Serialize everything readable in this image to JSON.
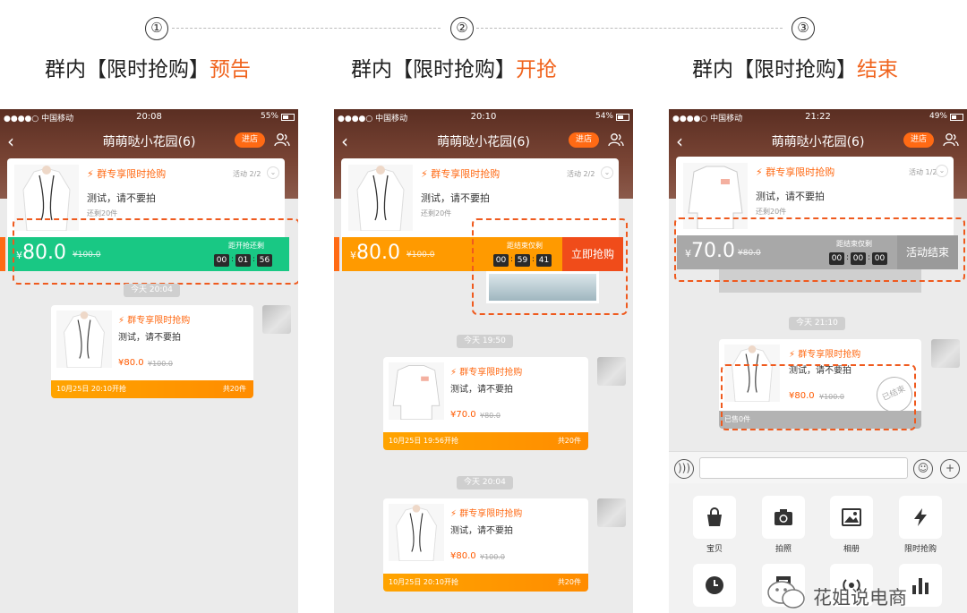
{
  "steps": [
    {
      "num": "①",
      "title_main": "群内【限时抢购】",
      "title_hl": "预告"
    },
    {
      "num": "②",
      "title_main": "群内【限时抢购】",
      "title_hl": "开抢"
    },
    {
      "num": "③",
      "title_main": "群内【限时抢购】",
      "title_hl": "结束"
    }
  ],
  "common": {
    "carrier": "●●●●○ 中国移动",
    "chat_title": "萌萌哒小花园(6)",
    "enter_label": "进店",
    "flash_label": "群专享限时抢购",
    "desc": "测试，请不要拍",
    "back": "‹",
    "flash_icon": "⚡"
  },
  "phones": [
    {
      "time": "20:08",
      "battery": "55%",
      "battery_level": 0.55,
      "activity": "活动 2/2",
      "remain": "还剩20件",
      "price": "80.0",
      "orig": "¥100.0",
      "countdown_label": "距开抢还剩",
      "digits": [
        "00",
        "01",
        "56"
      ],
      "bar_color": "#19c884",
      "pill": "今天 20:04",
      "messages": [
        {
          "price": "¥80.0",
          "orig": "¥100.0",
          "foot_left": "10月25日 20:10开抢",
          "foot_right": "共20件"
        }
      ]
    },
    {
      "time": "20:10",
      "battery": "54%",
      "battery_level": 0.54,
      "activity": "活动 2/2",
      "remain": "还剩20件",
      "price": "80.0",
      "orig": "¥100.0",
      "countdown_label": "距结束仅剩",
      "digits": [
        "00",
        "59",
        "41"
      ],
      "grab_label": "立即抢购",
      "bar_color": "#ff9a00",
      "pills": [
        "今天 19:50",
        "今天 20:04"
      ],
      "messages": [
        {
          "price": "¥70.0",
          "orig": "¥80.0",
          "foot_left": "10月25日 19:56开抢",
          "foot_right": "共20件"
        },
        {
          "price": "¥80.0",
          "orig": "¥100.0",
          "foot_left": "10月25日 20:10开抢",
          "foot_right": "共20件"
        }
      ]
    },
    {
      "time": "21:22",
      "battery": "49%",
      "battery_level": 0.49,
      "activity": "活动 1/2",
      "remain": "还剩20件",
      "price": "70.0",
      "orig": "¥80.0",
      "countdown_label": "距结束仅剩",
      "digits": [
        "00",
        "00",
        "00"
      ],
      "end_label": "活动结束",
      "bar_color": "#a8a8a8",
      "pill": "今天 21:10",
      "stamp": "已结束",
      "messages": [
        {
          "price": "¥80.0",
          "orig": "¥100.0",
          "foot_left": "已售0件"
        }
      ],
      "tools": [
        {
          "label": "宝贝",
          "icon": "bag-icon"
        },
        {
          "label": "拍照",
          "icon": "camera-icon"
        },
        {
          "label": "相册",
          "icon": "picture-icon"
        },
        {
          "label": "限时抢购",
          "icon": "lightning-icon"
        }
      ]
    }
  ],
  "watermark": "花姐说电商",
  "colors": {
    "accent": "#f0641e",
    "dash": "#ef5a1e",
    "orange": "#ff9a00",
    "green": "#19c884"
  }
}
